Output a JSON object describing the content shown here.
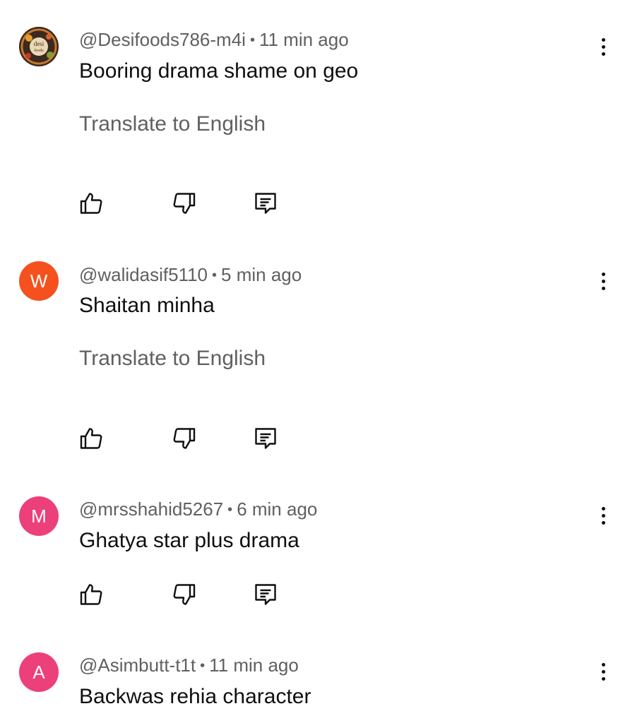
{
  "comments": [
    {
      "avatar_letter": "",
      "avatar_logo_text_1": "desi",
      "avatar_logo_text_2": "foods",
      "avatar_color": "#3b2a1e",
      "handle": "@Desifoods786-m4i",
      "time": "11 min ago",
      "text": "Booring drama shame on geo",
      "translate": "Translate to English"
    },
    {
      "avatar_letter": "W",
      "avatar_color": "#f4511e",
      "handle": "@walidasif5110",
      "time": "5 min ago",
      "text": "Shaitan minha",
      "translate": "Translate to English"
    },
    {
      "avatar_letter": "M",
      "avatar_color": "#ec407a",
      "handle": "@mrsshahid5267",
      "time": "6 min ago",
      "text": "Ghatya star plus drama",
      "translate": ""
    },
    {
      "avatar_letter": "A",
      "avatar_color": "#ec407a",
      "handle": "@Asimbutt-t1t",
      "time": "11 min ago",
      "text": "Backwas rehia character",
      "translate": ""
    }
  ],
  "icons": {
    "like": "thumbs-up-icon",
    "dislike": "thumbs-down-icon",
    "reply": "reply-icon",
    "more": "more-vert-icon"
  },
  "separator": "•"
}
